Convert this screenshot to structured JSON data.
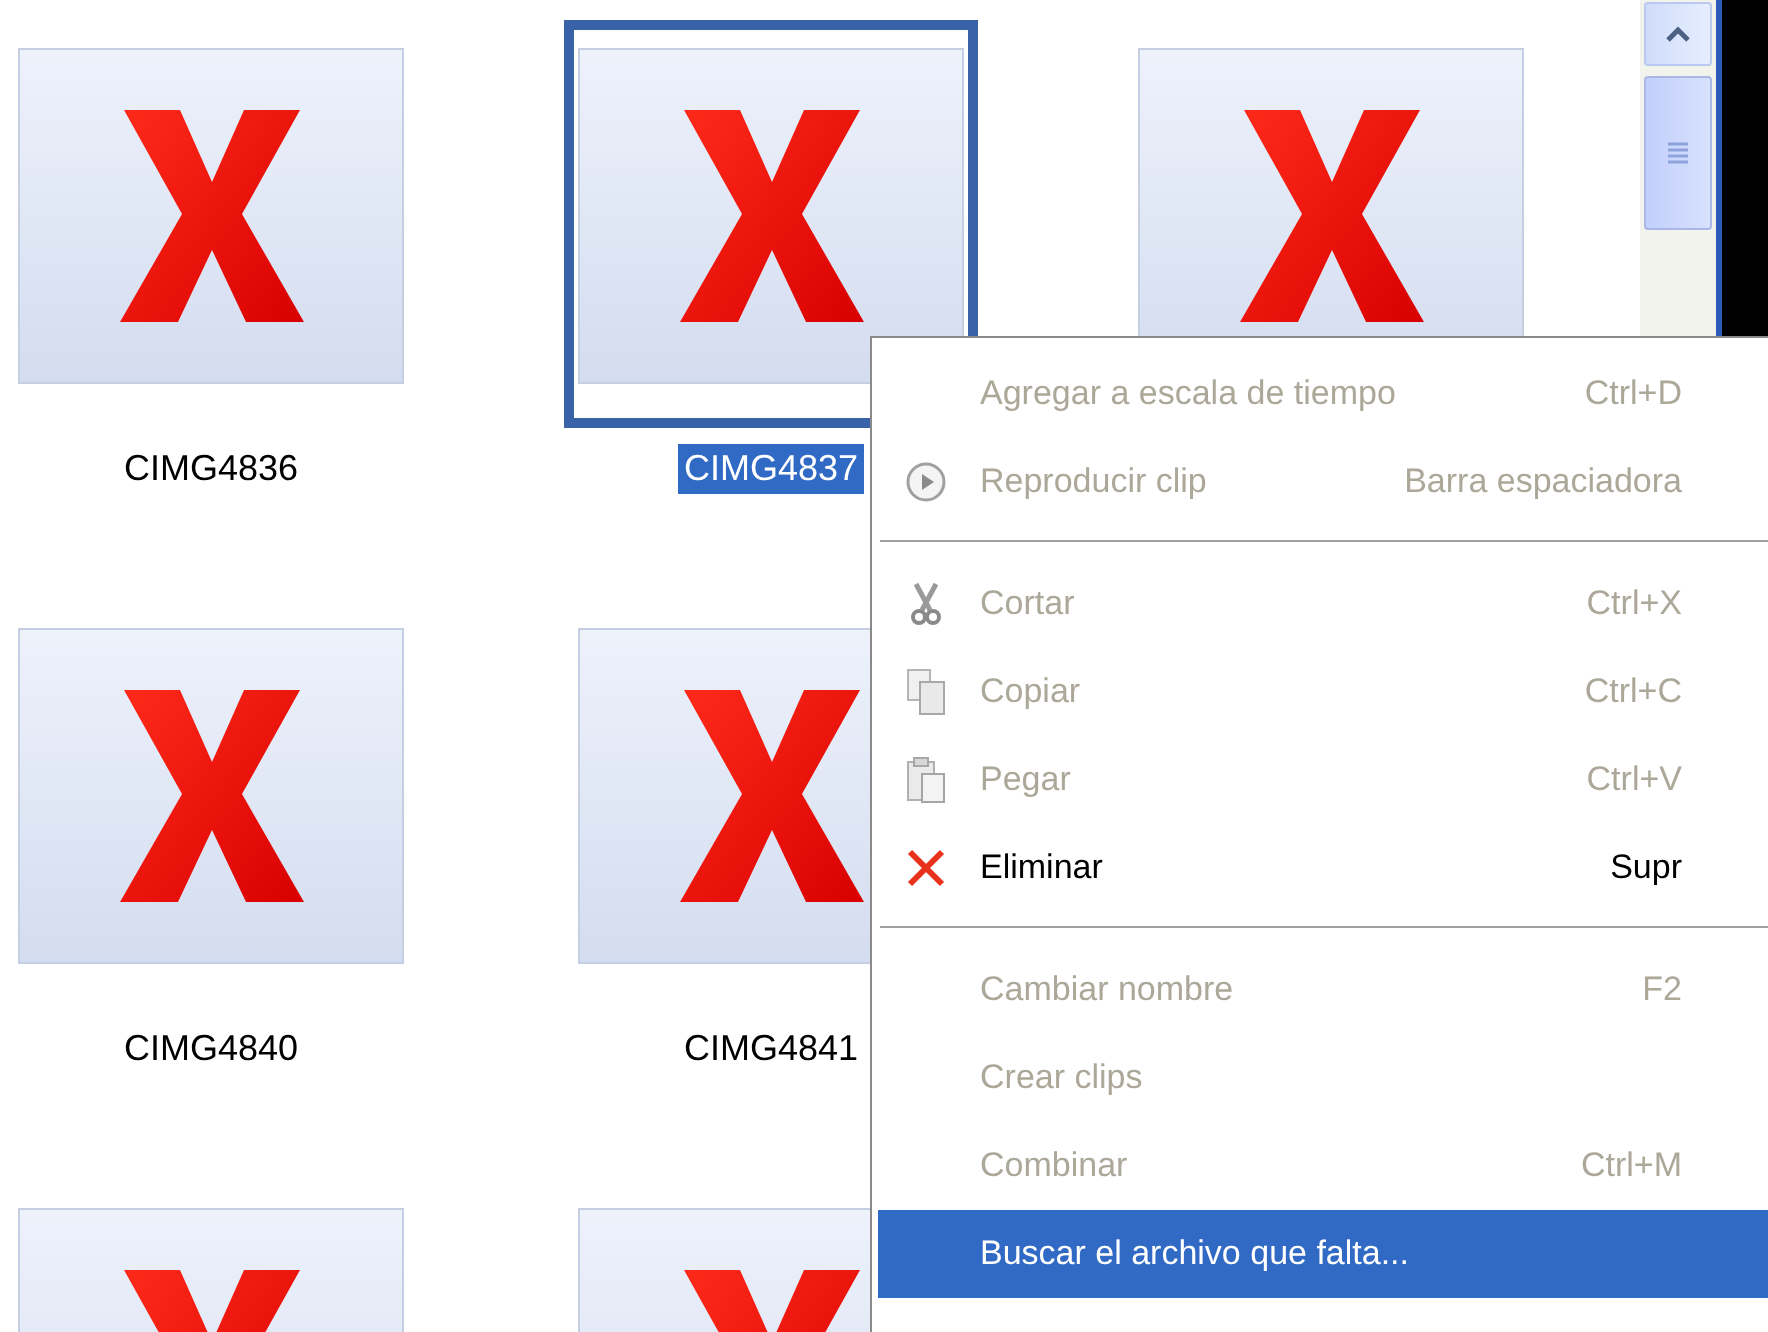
{
  "clip_rows": [
    [
      {
        "name": "CIMG4836",
        "selected": false
      },
      {
        "name": "CIMG4837",
        "selected": true
      },
      {
        "selected": false
      }
    ],
    [
      {
        "name": "CIMG4840",
        "selected": false
      },
      {
        "name": "CIMG4841",
        "selected": false
      }
    ],
    [
      {
        "selected": false
      },
      {
        "selected": false
      }
    ]
  ],
  "context_menu": {
    "items": [
      {
        "kind": "item",
        "label": "Agregar a escala de tiempo",
        "shortcut": "Ctrl+D",
        "disabled": true,
        "selected": false
      },
      {
        "kind": "item",
        "label": "Reproducir clip",
        "shortcut": "Barra espaciadora",
        "disabled": true,
        "selected": false
      },
      {
        "kind": "separator"
      },
      {
        "kind": "item",
        "label": "Cortar",
        "shortcut": "Ctrl+X",
        "disabled": true,
        "selected": false
      },
      {
        "kind": "item",
        "label": "Copiar",
        "shortcut": "Ctrl+C",
        "disabled": true,
        "selected": false
      },
      {
        "kind": "item",
        "label": "Pegar",
        "shortcut": "Ctrl+V",
        "disabled": true,
        "selected": false
      },
      {
        "kind": "item",
        "label": "Eliminar",
        "shortcut": "Supr",
        "disabled": false,
        "selected": false
      },
      {
        "kind": "separator"
      },
      {
        "kind": "item",
        "label": "Cambiar nombre",
        "shortcut": "F2",
        "disabled": true,
        "selected": false
      },
      {
        "kind": "item",
        "label": "Crear clips",
        "disabled": true,
        "selected": false
      },
      {
        "kind": "item",
        "label": "Combinar",
        "shortcut": "Ctrl+M",
        "disabled": true,
        "selected": false
      },
      {
        "kind": "item",
        "label": "Buscar el archivo que falta...",
        "disabled": false,
        "selected": true
      }
    ]
  }
}
